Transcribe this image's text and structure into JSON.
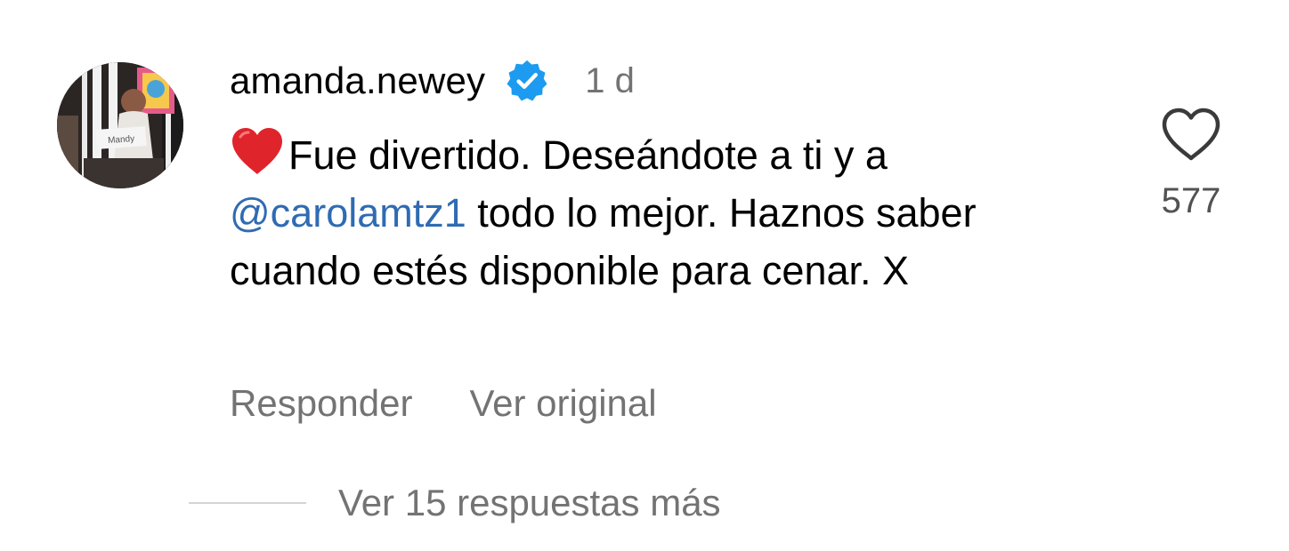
{
  "comment": {
    "avatar_sign_text": "Mandy",
    "username": "amanda.newey",
    "timestamp": "1 d",
    "emoji": "heart-emoji",
    "text_before_mention": "Fue divertido. Deseándote a ti y a ",
    "mention": "@carolamtz1",
    "text_after_mention": " todo lo mejor. Haznos saber cuando estés disponible para cenar. X",
    "like_icon": "heart-outline-icon",
    "like_count": "577",
    "actions": {
      "reply": "Responder",
      "see_original": "Ver original"
    },
    "view_replies": "Ver 15 respuestas más"
  },
  "colors": {
    "mention": "#2f6bb3",
    "verified_badge": "#1d9bf0",
    "heart_emoji": "#e0242b",
    "secondary_text": "#737373"
  }
}
